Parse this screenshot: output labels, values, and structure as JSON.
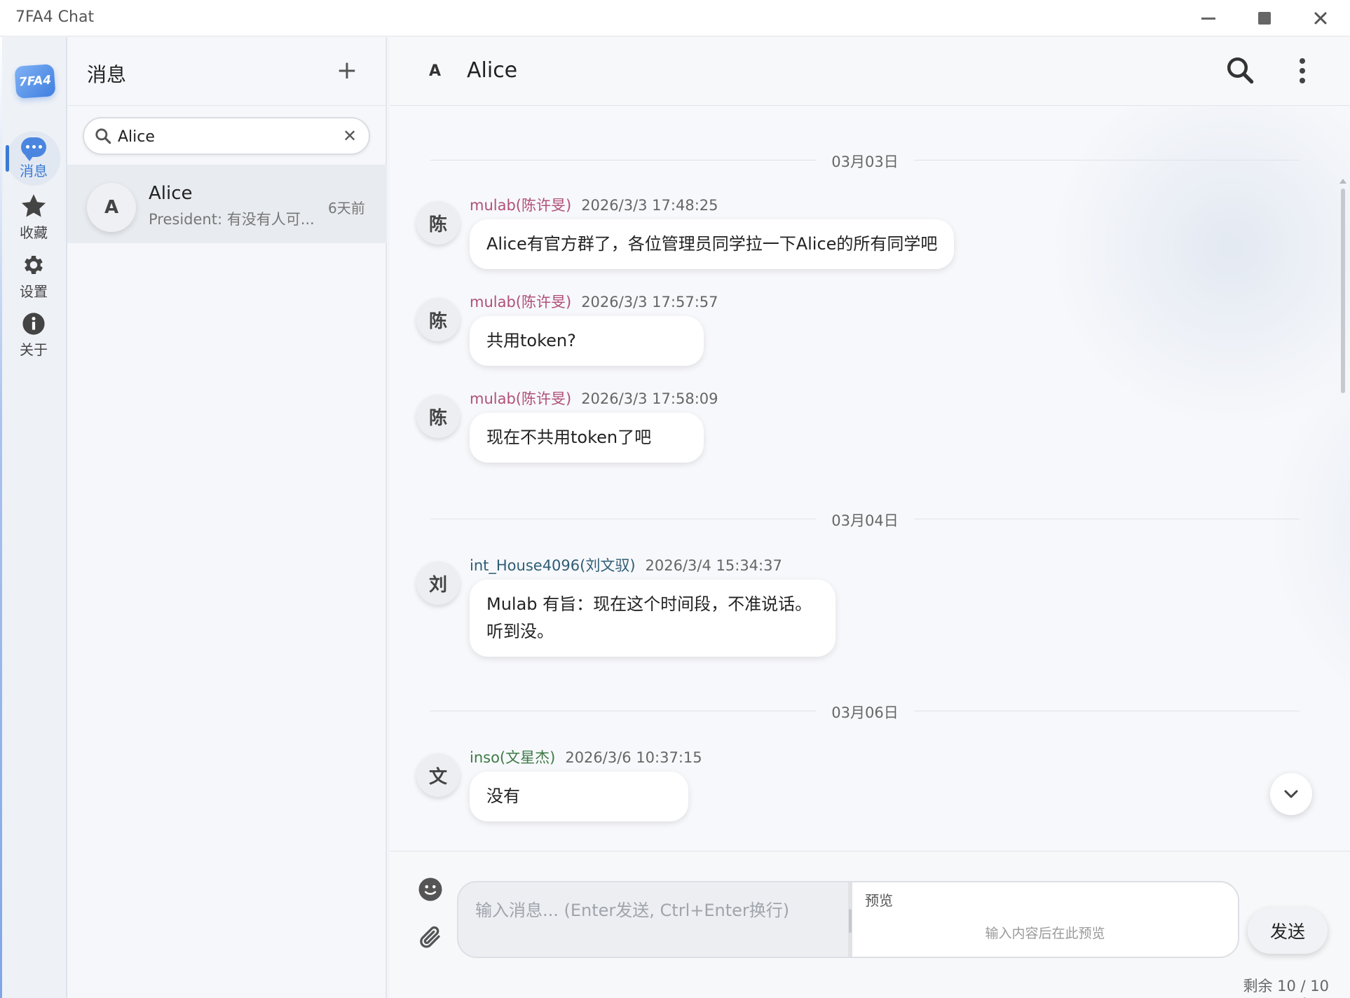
{
  "window": {
    "title": "7FA4 Chat"
  },
  "rail": {
    "logo": "7FA4",
    "items": [
      {
        "label": "消息",
        "icon": "chat-bubble-icon",
        "active": true
      },
      {
        "label": "收藏",
        "icon": "star-icon",
        "active": false
      },
      {
        "label": "设置",
        "icon": "gear-icon",
        "active": false
      },
      {
        "label": "关于",
        "icon": "info-icon",
        "active": false
      }
    ]
  },
  "list": {
    "heading": "消息",
    "add_label": "+",
    "search": {
      "value": "Alice",
      "clear": "✕"
    },
    "conversations": [
      {
        "avatar": "A",
        "name": "Alice",
        "preview": "President: 有没有人可...",
        "time": "6天前"
      }
    ]
  },
  "chat": {
    "avatar": "A",
    "title": "Alice",
    "dates": [
      "03月03日",
      "03月04日",
      "03月06日"
    ],
    "messages": [
      {
        "avatar": "陈",
        "sender": "mulab(陈许旻)",
        "time": "2026/3/3 17:48:25",
        "text": "Alice有官方群了，各位管理员同学拉一下Alice的所有同学吧"
      },
      {
        "avatar": "陈",
        "sender": "mulab(陈许旻)",
        "time": "2026/3/3 17:57:57",
        "text": "共用token?"
      },
      {
        "avatar": "陈",
        "sender": "mulab(陈许旻)",
        "time": "2026/3/3 17:58:09",
        "text": "现在不共用token了吧"
      },
      {
        "avatar": "刘",
        "sender": "int_House4096(刘文驭)",
        "time": "2026/3/4 15:34:37",
        "text_line1": "Mulab 有旨：现在这个时间段，不准说话。",
        "text_line2": "听到没。"
      },
      {
        "avatar": "文",
        "sender": "inso(文星杰)",
        "time": "2026/3/6 10:37:15",
        "text": "没有"
      }
    ],
    "colors": {
      "mulab": "#b05078",
      "int_House4096": "#2f5d75",
      "inso": "#3e7a45"
    }
  },
  "composer": {
    "placeholder": "输入消息... (Enter发送, Ctrl+Enter换行)",
    "preview_label": "预览",
    "preview_hint": "输入内容后在此预览",
    "send_label": "发送",
    "tokens": "剩余 10 / 10 token"
  }
}
